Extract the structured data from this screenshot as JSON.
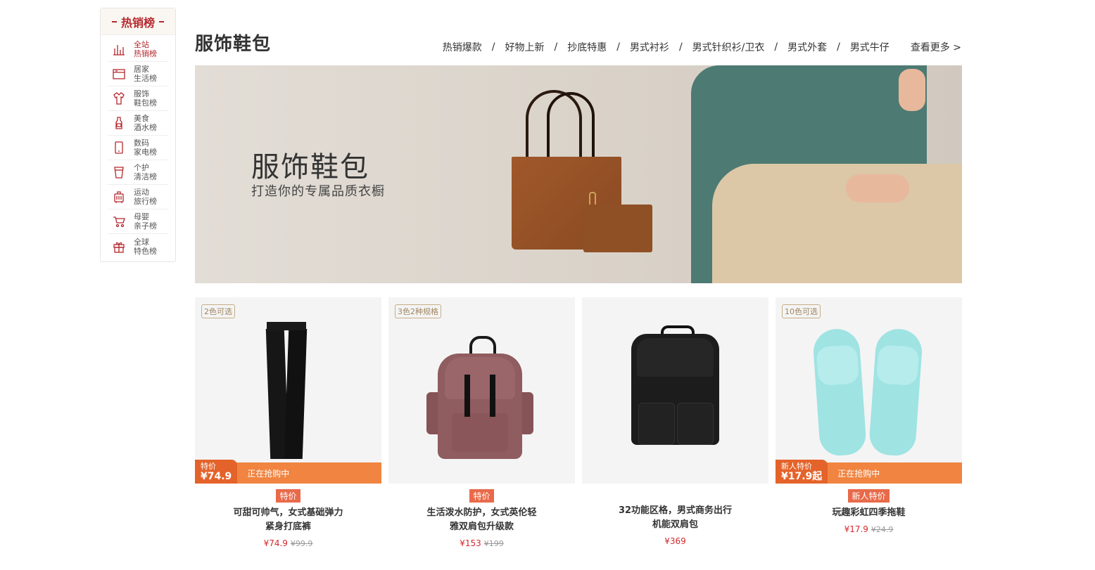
{
  "sidebar": {
    "header": "热销榜",
    "items": [
      {
        "line1": "全站",
        "line2": "热销榜",
        "icon": "bar-chart-icon",
        "active": true
      },
      {
        "line1": "居家",
        "line2": "生活榜",
        "icon": "home-appliance-icon",
        "active": false
      },
      {
        "line1": "服饰",
        "line2": "鞋包榜",
        "icon": "clothing-icon",
        "active": false
      },
      {
        "line1": "美食",
        "line2": "酒水榜",
        "icon": "bottle-icon",
        "active": false
      },
      {
        "line1": "数码",
        "line2": "家电榜",
        "icon": "phone-icon",
        "active": false
      },
      {
        "line1": "个护",
        "line2": "清洁榜",
        "icon": "cup-icon",
        "active": false
      },
      {
        "line1": "运动",
        "line2": "旅行榜",
        "icon": "luggage-icon",
        "active": false
      },
      {
        "line1": "母婴",
        "line2": "亲子榜",
        "icon": "stroller-icon",
        "active": false
      },
      {
        "line1": "全球",
        "line2": "特色榜",
        "icon": "gift-icon",
        "active": false
      }
    ]
  },
  "header": {
    "title": "服饰鞋包",
    "nav": [
      "热销爆款",
      "好物上新",
      "抄底特惠",
      "男式衬衫",
      "男式针织衫/卫衣",
      "男式外套",
      "男式牛仔"
    ],
    "separator": "/",
    "more": "查看更多 >"
  },
  "banner": {
    "title": "服饰鞋包",
    "subtitle": "打造你的专属品质衣橱"
  },
  "products": [
    {
      "tag": "2色可选",
      "promo": {
        "label": "特价",
        "price": "¥74.9",
        "status": "正在抢购中"
      },
      "badge": "特价",
      "name_line1": "可甜可帅气，女式基础弹力",
      "name_line2": "紧身打底裤",
      "price": "¥74.9",
      "old_price": "¥99.9"
    },
    {
      "tag": "3色2种规格",
      "badge": "特价",
      "name_line1": "生活泼水防护，女式英伦轻",
      "name_line2": "雅双肩包升级款",
      "price": "¥153",
      "old_price": "¥199"
    },
    {
      "tag": "",
      "badge": "",
      "name_line1": "32功能区格，男式商务出行",
      "name_line2": "机能双肩包",
      "price": "¥369",
      "old_price": ""
    },
    {
      "tag": "10色可选",
      "promo": {
        "label": "新人特价",
        "price": "¥17.9起",
        "status": "正在抢购中"
      },
      "badge": "新人特价",
      "name_line1": "玩趣彩虹四季拖鞋",
      "name_line2": "",
      "price": "¥17.9",
      "old_price": "¥24.9"
    }
  ],
  "colors": {
    "brand_red": "#b4282d",
    "promo_orange": "#f08440",
    "price_red": "#d4282d"
  }
}
